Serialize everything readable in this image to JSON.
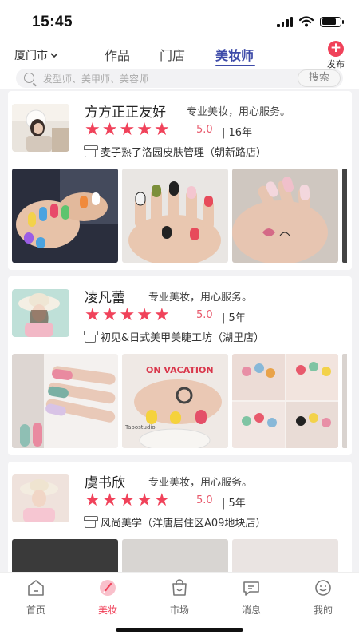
{
  "status_bar": {
    "time": "15:45"
  },
  "top_nav": {
    "city": "厦门市",
    "tabs": [
      {
        "label": "作品"
      },
      {
        "label": "门店"
      },
      {
        "label": "美妆师",
        "active": true
      }
    ],
    "publish_label": "发布",
    "accent_color": "#3d4aa8",
    "publish_color": "#f0425a"
  },
  "search": {
    "placeholder": "发型师、美甲师、美容师",
    "button_label": "搜索"
  },
  "artists": [
    {
      "name": "方方正正友好",
      "slogan": "专业美妆，用心服务。",
      "stars": 5,
      "rating": "5.0",
      "years": "| 16年",
      "shop": "麦子熟了洛园皮肤管理（朝新路店）"
    },
    {
      "name": "凌凡蕾",
      "slogan": "专业美妆，用心服务。",
      "stars": 5,
      "rating": "5.0",
      "years": "| 5年",
      "shop": "初见&日式美甲美睫工坊（湖里店）"
    },
    {
      "name": "虞书欣",
      "slogan": "专业美妆，用心服务。",
      "stars": 5,
      "rating": "5.0",
      "years": "| 5年",
      "shop": "风尚美学（洋唐居住区A09地块店）"
    }
  ],
  "photo_text": {
    "banner": "ON VACATION",
    "watermark": "Tabostudio"
  },
  "bottom_nav": [
    {
      "label": "首页",
      "icon": "home-icon"
    },
    {
      "label": "美妆",
      "icon": "makeup-icon",
      "active": true
    },
    {
      "label": "市场",
      "icon": "market-bag-icon"
    },
    {
      "label": "消息",
      "icon": "message-icon"
    },
    {
      "label": "我的",
      "icon": "profile-icon"
    }
  ],
  "colors": {
    "star": "#f0425a",
    "active_tab": "#3d4aa8",
    "active_bottom": "#f0425a"
  }
}
